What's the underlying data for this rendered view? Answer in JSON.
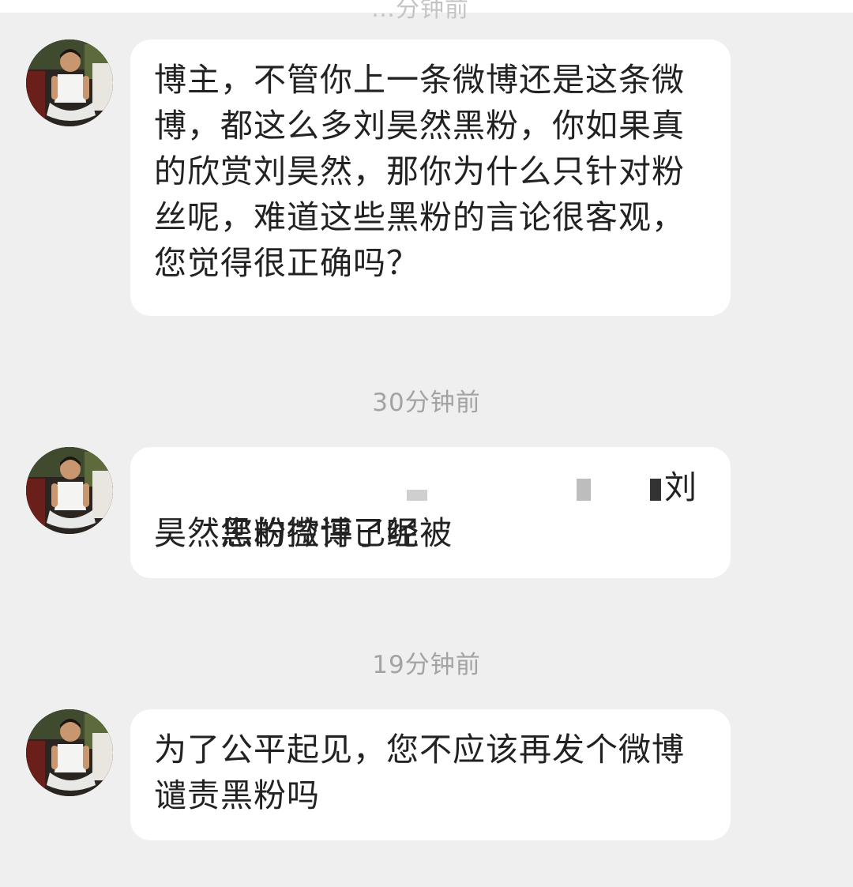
{
  "top_partial_time": "…分钟前",
  "messages": [
    {
      "avatar_icon": "user-avatar-boy-photo",
      "text": "博主，不管你上一条微博还是这条微博，都这么多刘昊然黑粉，你如果真的欣赏刘昊然，那你为什么只针对粉丝呢，难道这些黑粉的言论很客观，您觉得很正确吗？"
    },
    {
      "timestamp": "30分钟前",
      "avatar_icon": "user-avatar-boy-photo",
      "line1_start": "您的微博已经被",
      "line1_end": "刘",
      "line2": "昊然黑粉控评了呢"
    },
    {
      "timestamp": "19分钟前",
      "avatar_icon": "user-avatar-boy-photo",
      "text": "为了公平起见，您不应该再发个微博谴责黑粉吗"
    }
  ],
  "colors": {
    "background": "#efefef",
    "bubble": "#ffffff",
    "text": "#222222",
    "timestamp": "#a3a3a3"
  }
}
